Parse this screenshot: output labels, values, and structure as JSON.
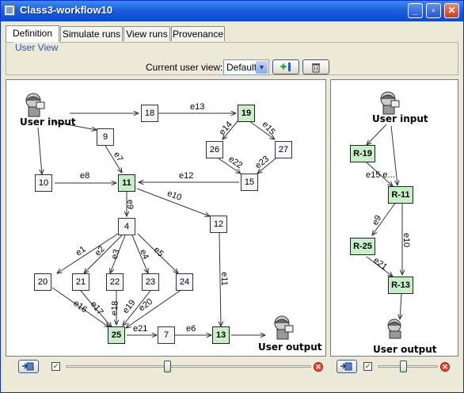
{
  "window": {
    "title": "Class3-workflow10",
    "min_label": "_",
    "max_label": "▫",
    "close_label": "✕"
  },
  "tabs": [
    {
      "label": "Definition"
    },
    {
      "label": "Simulate runs"
    },
    {
      "label": "View runs"
    },
    {
      "label": "Provenance"
    }
  ],
  "user_view": {
    "legend": "User View",
    "current_label": "Current user view:",
    "selected": "Default",
    "add_icon": "add-view-icon",
    "delete_icon": "trash-icon"
  },
  "left_graph": {
    "input_label": "User input",
    "output_label": "User output",
    "nodes": [
      "18",
      "19",
      "9",
      "26",
      "27",
      "10",
      "11",
      "15",
      "4",
      "12",
      "20",
      "21",
      "22",
      "23",
      "24",
      "25",
      "7",
      "13"
    ],
    "edges": [
      "e13",
      "e14",
      "e15",
      "e7",
      "e22",
      "e23",
      "e8",
      "e12",
      "e10",
      "e9",
      "e1",
      "e2",
      "e3",
      "e4",
      "e5",
      "e11",
      "e16",
      "e17",
      "e18",
      "e19",
      "e20",
      "e21",
      "e6"
    ]
  },
  "right_graph": {
    "input_label": "User input",
    "output_label": "User output",
    "nodes": [
      "R-19",
      "R-11",
      "R-25",
      "R-13"
    ],
    "edges": [
      "e15 e...",
      "e9",
      "e10",
      "e21"
    ]
  },
  "colors": {
    "processor_fill": "#c8f0c8",
    "port_fill": "#f5f5fa",
    "accent": "#0a4ad2"
  }
}
